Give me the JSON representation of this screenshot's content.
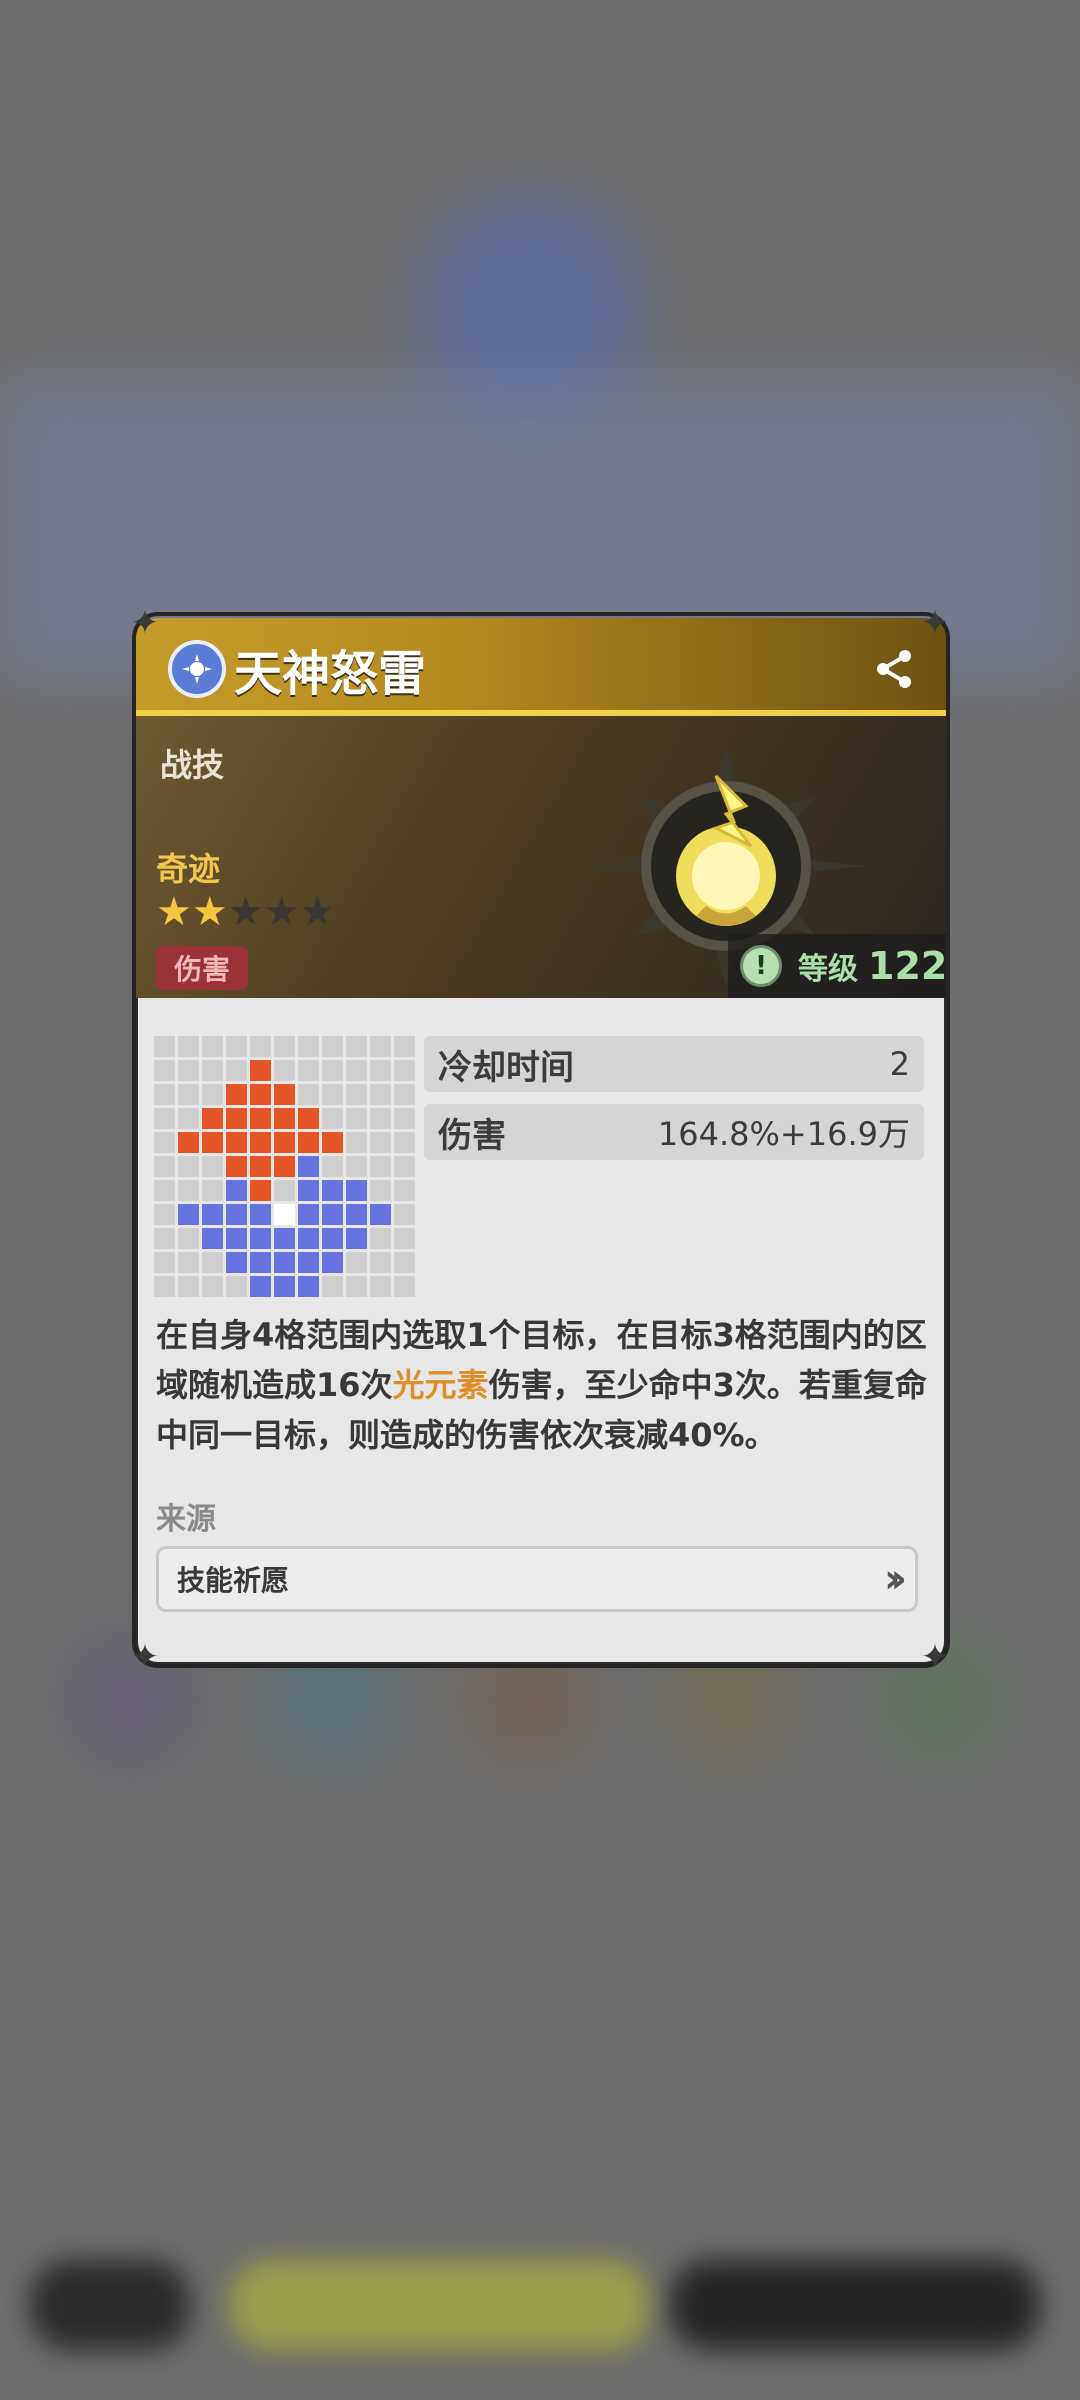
{
  "skill": {
    "title": "天神怒雷",
    "type_label": "战技",
    "rarity_label": "奇迹",
    "stars_filled": 2,
    "stars_total": 5,
    "tag": "伤害",
    "level_label": "等级",
    "level_value": "122"
  },
  "stats": [
    {
      "label": "冷却时间",
      "value": "2"
    },
    {
      "label": "伤害",
      "value": "164.8%+16.9万"
    }
  ],
  "description": {
    "part1": "在自身4格范围内选取1个目标，在目标3格范围内的区域随机造成16次",
    "highlight": "光元素",
    "part2": "伤害，至少命中3次。若重复命中同一目标，则造成的伤害依次衰减40%。"
  },
  "source": {
    "title": "来源",
    "item_label": "技能祈愿"
  },
  "range_grid": [
    "...........",
    "....r......",
    "...rrr.....",
    "..rrrrr....",
    ".rrrrrrr...",
    "...rrrb....",
    "...br.bbb..",
    ".bbbbwbbbb.",
    "..bbbbbbb..",
    "...bbbbb...",
    "....bbb...."
  ],
  "icons": {
    "title": "element-light-icon",
    "share": "share-icon",
    "level": "alert-icon",
    "source_arrow": "double-chevron-right-icon"
  },
  "colors": {
    "header_gold": "#c59c2a",
    "damage_tag": "#9b3238",
    "highlight": "#e08f28",
    "range_red": "#e65528",
    "range_blue": "#6774e0",
    "level_green": "#a9e0a6"
  }
}
